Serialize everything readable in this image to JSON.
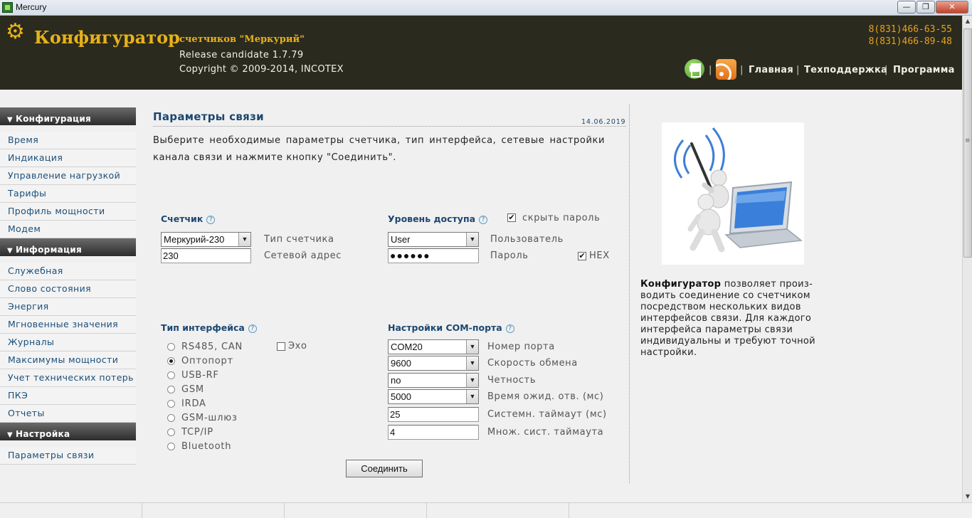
{
  "window": {
    "title": "Mercury",
    "min_glyph": "—",
    "max_glyph": "❐",
    "close_glyph": "✕"
  },
  "header": {
    "app_name": "Конфигуратор",
    "app_sub": "счетчиков \"Меркурий\"",
    "release": "Release candidate 1.7.79",
    "copyright": "Copyright © 2009-2014, INCOTEX",
    "phones": [
      "8(831)466-63-55",
      "8(831)466-89-48"
    ],
    "separator": "|",
    "links": [
      "Главная",
      "Техподдержка",
      "Программа"
    ],
    "icons": {
      "gear": "gear-icon",
      "print": "print-icon",
      "rss": "rss-icon"
    },
    "accent_color": "#e7b21a"
  },
  "sidebar": {
    "sections": [
      {
        "title": "Конфигурация",
        "items": [
          "Время",
          "Индикация",
          "Управление нагрузкой",
          "Тарифы",
          "Профиль мощности",
          "Модем"
        ]
      },
      {
        "title": "Информация",
        "items": [
          "Служебная",
          "Слово состояния",
          "Энергия",
          "Мгновенные значения",
          "Журналы",
          "Максимумы мощности",
          "Учет технических потерь",
          "ПКЭ",
          "Отчеты"
        ]
      },
      {
        "title": "Настройка",
        "items": [
          "Параметры связи"
        ]
      }
    ],
    "triangle": "▼"
  },
  "main": {
    "title": "Параметры связи",
    "date": "14.06.2019",
    "intro": "Выберите необходимые параметры счетчика, тип интерфейса, сетевые настройки канала связи и нажмите кнопку \"Соединить\".",
    "help_glyph": "?",
    "meter": {
      "label": "Счетчик",
      "type_value": "Меркурий-230",
      "type_desc": "Тип счетчика",
      "address_value": "230",
      "address_desc": "Сетевой адрес"
    },
    "access": {
      "label": "Уровень доступа",
      "hide_password_label": "скрыть пароль",
      "hide_password_checked": true,
      "user_value": "User",
      "user_desc": "Пользователь",
      "password_value": "●●●●●●",
      "password_desc": "Пароль",
      "hex_label": "HEX",
      "hex_checked": true
    },
    "interface": {
      "label": "Тип интерфейса",
      "echo_label": "Эхо",
      "echo_checked": false,
      "options": [
        "RS485, CAN",
        "Оптопорт",
        "USB-RF",
        "GSM",
        "IRDA",
        "GSM-шлюз",
        "TCP/IP",
        "Bluetooth"
      ],
      "selected": "Оптопорт"
    },
    "com": {
      "label": "Настройки COM-порта",
      "port_value": "COM20",
      "port_desc": "Номер порта",
      "speed_value": "9600",
      "speed_desc": "Скорость обмена",
      "parity_value": "no",
      "parity_desc": "Четность",
      "wait_value": "5000",
      "wait_desc": "Время ожид. отв. (мс)",
      "timeout_value": "25",
      "timeout_desc": "Системн. таймаут (мс)",
      "mult_value": "4",
      "mult_desc": "Множ. сист. таймаута"
    },
    "connect_label": "Соединить",
    "check_glyph": "✔",
    "arrow_glyph": "▼"
  },
  "right": {
    "desc_bold": "Конфигуратор",
    "desc_rest": " позволяет произ-водить соединение со счетчиком посредством нескольких видов интерфейсов связи. Для каждого интерфейса параметры связи индивидуальны и требуют точной настройки."
  }
}
